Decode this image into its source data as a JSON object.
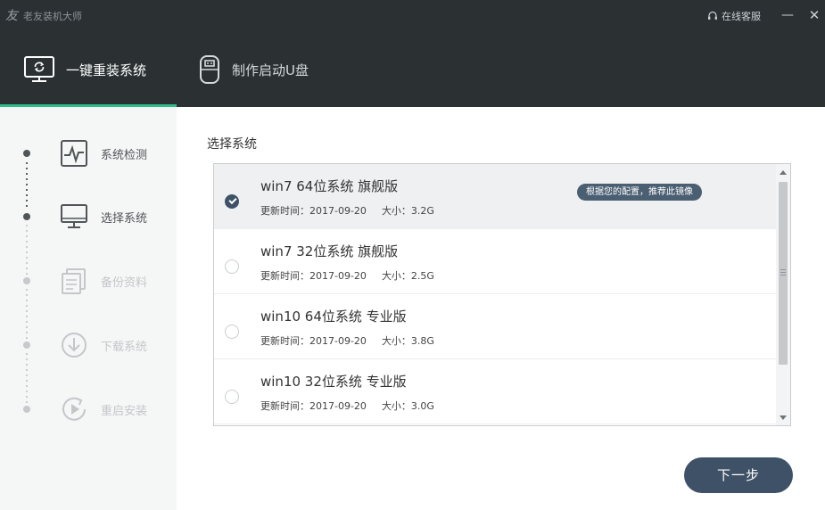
{
  "titlebar": {
    "app_name": "老友装机大师",
    "service_label": "在线客服",
    "minimize_icon": "minimize-icon",
    "close_icon": "close-icon"
  },
  "tabs": [
    {
      "label": "一键重装系统",
      "icon": "monitor-refresh-icon",
      "active": true
    },
    {
      "label": "制作启动U盘",
      "icon": "usb-drive-icon",
      "active": false
    }
  ],
  "steps": [
    {
      "label": "系统检测",
      "icon": "system-check-icon",
      "state": "done"
    },
    {
      "label": "选择系统",
      "icon": "monitor-icon",
      "state": "active"
    },
    {
      "label": "备份资料",
      "icon": "backup-icon",
      "state": "pending"
    },
    {
      "label": "下载系统",
      "icon": "download-icon",
      "state": "pending"
    },
    {
      "label": "重启安装",
      "icon": "restart-install-icon",
      "state": "pending"
    }
  ],
  "main": {
    "section_title": "选择系统",
    "os_list": [
      {
        "name": "win7 64位系统 旗舰版",
        "updated": "更新时间：2017-09-20",
        "size": "大小：3.2G",
        "selected": true,
        "badge": "根据您的配置，推荐此镜像"
      },
      {
        "name": "win7 32位系统 旗舰版",
        "updated": "更新时间：2017-09-20",
        "size": "大小：2.5G",
        "selected": false
      },
      {
        "name": "win10 64位系统 专业版",
        "updated": "更新时间：2017-09-20",
        "size": "大小：3.8G",
        "selected": false
      },
      {
        "name": "win10 32位系统 专业版",
        "updated": "更新时间：2017-09-20",
        "size": "大小：3.0G",
        "selected": false
      }
    ],
    "next_label": "下一步"
  },
  "colors": {
    "header_bg": "#2b3033",
    "tab_indicator": "#2fbf86",
    "sidebar_bg": "#f5f6f6",
    "accent": "#3e5166"
  }
}
